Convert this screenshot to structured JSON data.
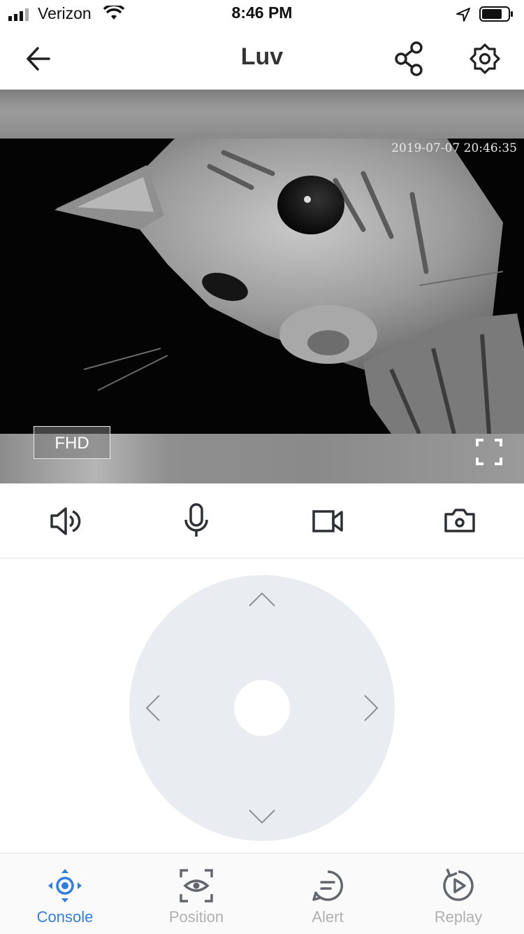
{
  "status_bar": {
    "carrier": "Verizon",
    "time": "8:46 PM"
  },
  "header": {
    "title": "Luv"
  },
  "video": {
    "timestamp": "2019-07-07 20:46:35",
    "quality_label": "FHD"
  },
  "controls": [
    {
      "name": "speaker-icon"
    },
    {
      "name": "microphone-icon"
    },
    {
      "name": "record-video-icon"
    },
    {
      "name": "snapshot-camera-icon"
    }
  ],
  "tabs": [
    {
      "label": "Console",
      "active": true
    },
    {
      "label": "Position",
      "active": false
    },
    {
      "label": "Alert",
      "active": false
    },
    {
      "label": "Replay",
      "active": false
    }
  ],
  "colors": {
    "accent": "#2f7de1",
    "inactive": "#b0b0b0",
    "joystick": "#e9ecf0"
  }
}
